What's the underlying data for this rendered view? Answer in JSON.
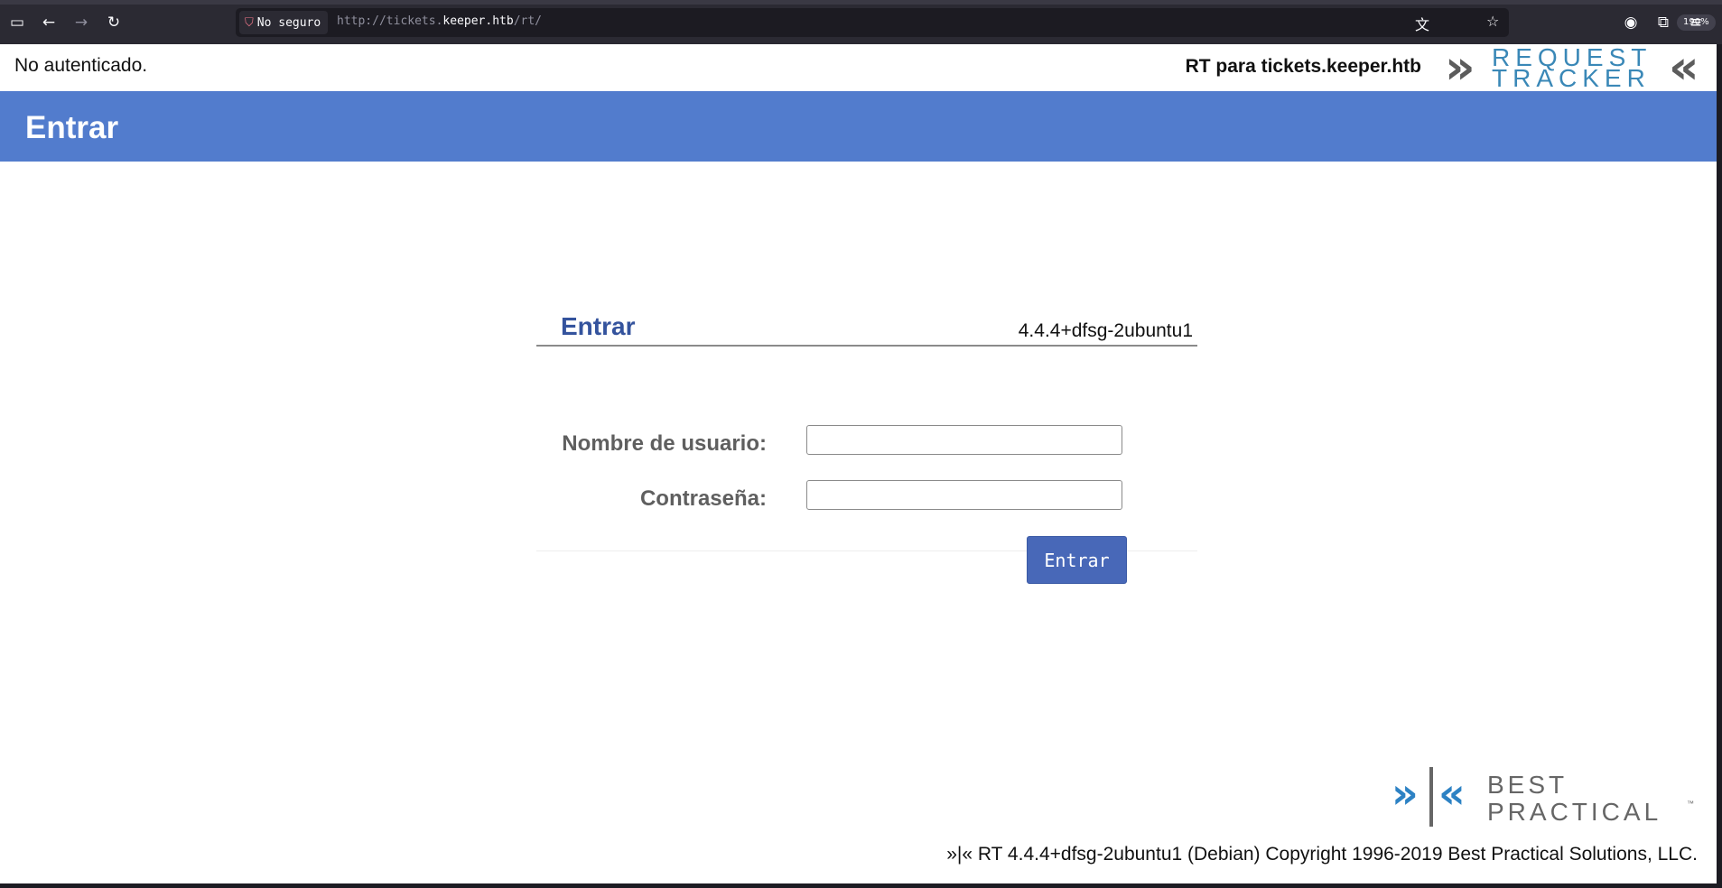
{
  "browser": {
    "security_label": "No seguro",
    "url_prefix": "http://tickets.",
    "url_host": "keeper.htb",
    "url_path": "/rt/",
    "zoom": "190%"
  },
  "header": {
    "auth_status": "No autenticado.",
    "rt_for": "RT para tickets.keeper.htb",
    "logo": {
      "line1": "REQUEST",
      "line2": "TRACKER",
      "color": "#3a88b7"
    }
  },
  "title_bar": {
    "title": "Entrar",
    "color": "#527ccd"
  },
  "login": {
    "legend": "Entrar",
    "version": "4.4.4+dfsg-2ubuntu1",
    "username_label": "Nombre de usuario:",
    "username_value": "",
    "password_label": "Contraseña:",
    "password_value": "",
    "submit_label": "Entrar"
  },
  "footer": {
    "logo": {
      "line1": "BEST",
      "line2": "PRACTICAL",
      "tm": "™"
    },
    "copyright": "»|« RT 4.4.4+dfsg-2ubuntu1 (Debian) Copyright 1996-2019 Best Practical Solutions, LLC."
  }
}
